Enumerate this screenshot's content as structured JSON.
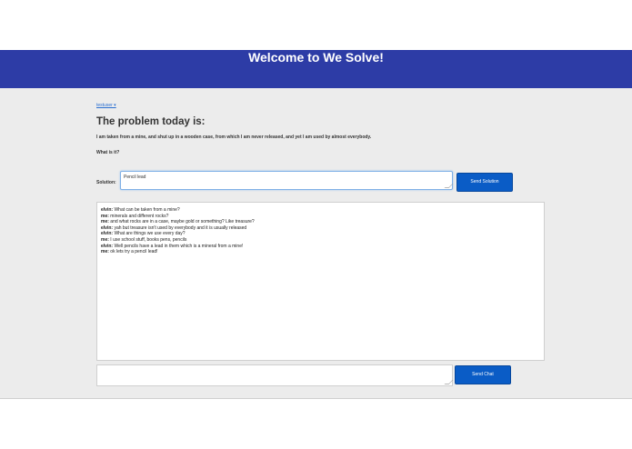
{
  "header": {
    "title": "Welcome to We Solve!"
  },
  "user_menu": {
    "label": "testuser ▾"
  },
  "problem": {
    "heading": "The problem today is:",
    "text": "I am taken from a mine, and shut up in a wooden case, from which I am never released, and yet I am used by almost everybody.",
    "question": "What is it?"
  },
  "solution": {
    "label": "Solution:",
    "value": "Pencil lead",
    "button": "Send Solution"
  },
  "chat": {
    "messages": [
      {
        "user": "elvin:",
        "text": " What can be taken from a mine?"
      },
      {
        "user": "me:",
        "text": " minerals and different rocks?"
      },
      {
        "user": "me:",
        "text": " and what rocks are in a case, maybe gold or something? Like treasure?"
      },
      {
        "user": "elvin:",
        "text": " yah but treasure isn't used by everybody and it is usually released"
      },
      {
        "user": "elvin:",
        "text": " What are things we use every day?"
      },
      {
        "user": "me:",
        "text": " I use school stuff, books pens, pencils"
      },
      {
        "user": "elvin:",
        "text": " Well pencils have a lead in them which is a mineral from a mine!"
      },
      {
        "user": "me:",
        "text": " ok lets try a pencil lead!"
      }
    ],
    "input_value": "",
    "button": "Send Chat"
  }
}
